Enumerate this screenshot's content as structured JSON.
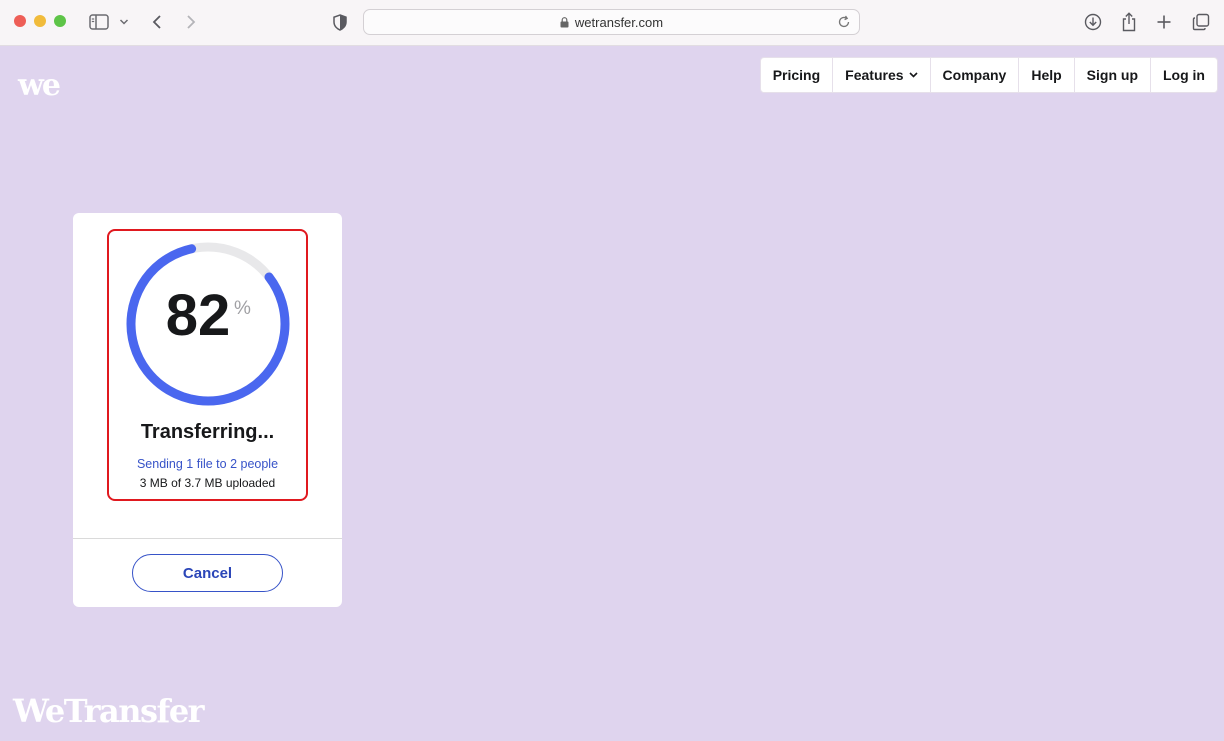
{
  "browser": {
    "url": "wetransfer.com"
  },
  "brand": {
    "logo_short": "we",
    "wordmark": "WeTransfer"
  },
  "nav": {
    "items": [
      {
        "label": "Pricing"
      },
      {
        "label": "Features"
      },
      {
        "label": "Company"
      },
      {
        "label": "Help"
      },
      {
        "label": "Sign up"
      },
      {
        "label": "Log in"
      }
    ]
  },
  "transfer": {
    "percent": "82",
    "percent_sign": "%",
    "progress_fraction": 0.82,
    "title": "Transferring...",
    "subtitle": "Sending 1 file to 2 people",
    "uploaded": "3 MB of 3.7 MB uploaded",
    "cancel_label": "Cancel"
  },
  "colors": {
    "page_bg": "#dfd4ee",
    "progress": "#4a67ef",
    "track": "#e8e8ea",
    "accent_link": "#3753c8",
    "highlight": "#e0191f"
  }
}
